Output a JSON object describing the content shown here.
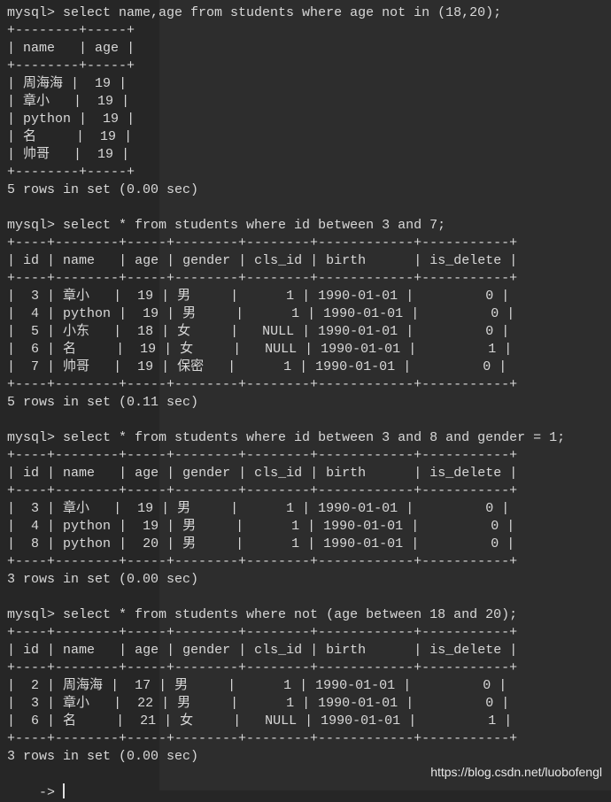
{
  "prompt": "mysql> ",
  "continuation_prompt": "    -> ",
  "queries": [
    {
      "sql": "select name,age from students where age not in (18,20);",
      "columns": [
        "name",
        "age"
      ],
      "numeric": [
        false,
        true
      ],
      "rows": [
        [
          "周海海",
          "19"
        ],
        [
          "章小",
          "19"
        ],
        [
          "python",
          "19"
        ],
        [
          "名",
          "19"
        ],
        [
          "帅哥",
          "19"
        ]
      ],
      "footer": "5 rows in set (0.00 sec)"
    },
    {
      "sql": "select * from students where id between 3 and 7;",
      "columns": [
        "id",
        "name",
        "age",
        "gender",
        "cls_id",
        "birth",
        "is_delete"
      ],
      "numeric": [
        true,
        false,
        true,
        false,
        true,
        false,
        true
      ],
      "rows": [
        [
          "3",
          "章小",
          "19",
          "男",
          "1",
          "1990-01-01",
          "0"
        ],
        [
          "4",
          "python",
          "19",
          "男",
          "1",
          "1990-01-01",
          "0"
        ],
        [
          "5",
          "小东",
          "18",
          "女",
          "NULL",
          "1990-01-01",
          "0"
        ],
        [
          "6",
          "名",
          "19",
          "女",
          "NULL",
          "1990-01-01",
          "1"
        ],
        [
          "7",
          "帅哥",
          "19",
          "保密",
          "1",
          "1990-01-01",
          "0"
        ]
      ],
      "footer": "5 rows in set (0.11 sec)"
    },
    {
      "sql": "select * from students where id between 3 and 8 and gender = 1;",
      "columns": [
        "id",
        "name",
        "age",
        "gender",
        "cls_id",
        "birth",
        "is_delete"
      ],
      "numeric": [
        true,
        false,
        true,
        false,
        true,
        false,
        true
      ],
      "rows": [
        [
          "3",
          "章小",
          "19",
          "男",
          "1",
          "1990-01-01",
          "0"
        ],
        [
          "4",
          "python",
          "19",
          "男",
          "1",
          "1990-01-01",
          "0"
        ],
        [
          "8",
          "python",
          "20",
          "男",
          "1",
          "1990-01-01",
          "0"
        ]
      ],
      "footer": "3 rows in set (0.00 sec)"
    },
    {
      "sql": "select * from students where not (age between 18 and 20);",
      "columns": [
        "id",
        "name",
        "age",
        "gender",
        "cls_id",
        "birth",
        "is_delete"
      ],
      "numeric": [
        true,
        false,
        true,
        false,
        true,
        false,
        true
      ],
      "rows": [
        [
          "2",
          "周海海",
          "17",
          "男",
          "1",
          "1990-01-01",
          "0"
        ],
        [
          "3",
          "章小",
          "22",
          "男",
          "1",
          "1990-01-01",
          "0"
        ],
        [
          "6",
          "名",
          "21",
          "女",
          "NULL",
          "1990-01-01",
          "1"
        ]
      ],
      "footer": "3 rows in set (0.00 sec)"
    }
  ],
  "watermark": "https://blog.csdn.net/luobofengl"
}
